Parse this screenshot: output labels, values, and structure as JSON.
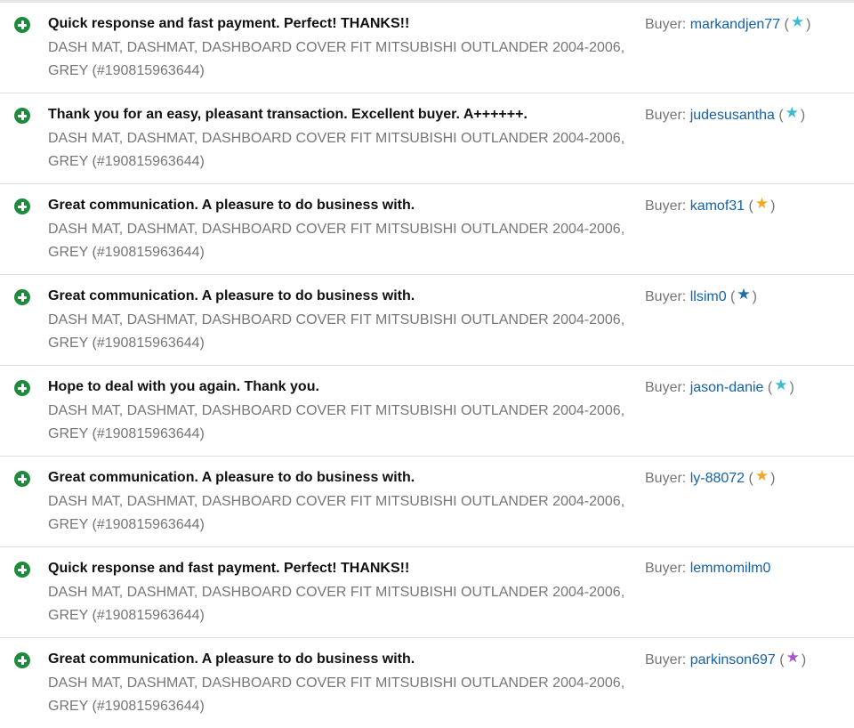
{
  "colors": {
    "positive": "#1d8a3c",
    "link": "#1561a6",
    "muted": "#767676",
    "star_turquoise": "#3fbad6",
    "star_blue": "#1a6fa6",
    "star_yellow": "#f5a623",
    "star_purple": "#a855c7"
  },
  "buyer_label": "Buyer:",
  "feedback": [
    {
      "icon": "positive-feedback-icon",
      "comment": "Quick response and fast payment. Perfect! THANKS!!",
      "item": "DASH MAT, DASHMAT, DASHBOARD COVER FIT MITSUBISHI OUTLANDER 2004-2006, GREY (#190815963644)",
      "buyer": "markandjen77",
      "star": "turquoise"
    },
    {
      "icon": "positive-feedback-icon",
      "comment": "Thank you for an easy, pleasant transaction. Excellent buyer. A++++++.",
      "item": "DASH MAT, DASHMAT, DASHBOARD COVER FIT MITSUBISHI OUTLANDER 2004-2006, GREY (#190815963644)",
      "buyer": "judesusantha",
      "star": "turquoise"
    },
    {
      "icon": "positive-feedback-icon",
      "comment": "Great communication. A pleasure to do business with.",
      "item": "DASH MAT, DASHMAT, DASHBOARD COVER FIT MITSUBISHI OUTLANDER 2004-2006, GREY (#190815963644)",
      "buyer": "kamof31",
      "star": "yellow"
    },
    {
      "icon": "positive-feedback-icon",
      "comment": "Great communication. A pleasure to do business with.",
      "item": "DASH MAT, DASHMAT, DASHBOARD COVER FIT MITSUBISHI OUTLANDER 2004-2006, GREY (#190815963644)",
      "buyer": "llsim0",
      "star": "blue"
    },
    {
      "icon": "positive-feedback-icon",
      "comment": "Hope to deal with you again. Thank you.",
      "item": "DASH MAT, DASHMAT, DASHBOARD COVER FIT MITSUBISHI OUTLANDER 2004-2006, GREY (#190815963644)",
      "buyer": "jason-danie",
      "star": "turquoise"
    },
    {
      "icon": "positive-feedback-icon",
      "comment": "Great communication. A pleasure to do business with.",
      "item": "DASH MAT, DASHMAT, DASHBOARD COVER FIT MITSUBISHI OUTLANDER 2004-2006, GREY (#190815963644)",
      "buyer": "ly-88072",
      "star": "yellow"
    },
    {
      "icon": "positive-feedback-icon",
      "comment": "Quick response and fast payment. Perfect! THANKS!!",
      "item": "DASH MAT, DASHMAT, DASHBOARD COVER FIT MITSUBISHI OUTLANDER 2004-2006, GREY (#190815963644)",
      "buyer": "lemmomilm0",
      "star": null
    },
    {
      "icon": "positive-feedback-icon",
      "comment": "Great communication. A pleasure to do business with.",
      "item": "DASH MAT, DASHMAT, DASHBOARD COVER FIT MITSUBISHI OUTLANDER 2004-2006, GREY (#190815963644)",
      "buyer": "parkinson697",
      "star": "purple"
    }
  ]
}
